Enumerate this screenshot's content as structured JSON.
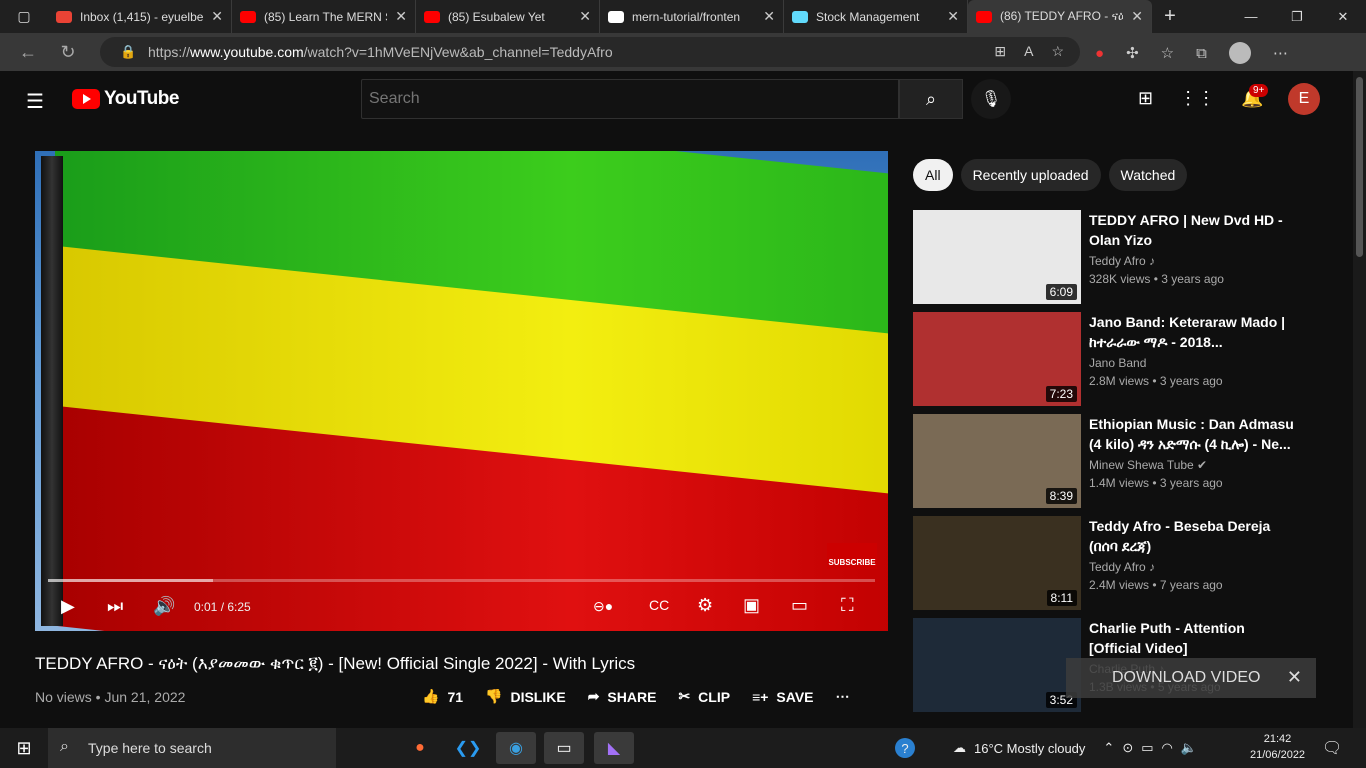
{
  "browser": {
    "tabs": [
      {
        "title": "Inbox (1,415) - eyuelbe",
        "favicon_color": "#ea4335",
        "icon": "gmail-icon"
      },
      {
        "title": "(85) Learn The MERN S",
        "favicon_color": "#ff0000",
        "icon": "youtube-icon"
      },
      {
        "title": "(85) Esubalew Yet",
        "favicon_color": "#ff0000",
        "icon": "youtube-icon"
      },
      {
        "title": "mern-tutorial/fronten",
        "favicon_color": "#ffffff",
        "icon": "github-icon"
      },
      {
        "title": "Stock Management",
        "favicon_color": "#61dafb",
        "icon": "react-icon"
      },
      {
        "title": "(86) TEDDY AFRO - ናዕ",
        "favicon_color": "#ff0000",
        "icon": "youtube-icon"
      }
    ],
    "url_prefix": "https://",
    "url_host": "www.youtube.com",
    "url_path": "/watch?v=1hMVeENjVew&ab_channel=TeddyAfro"
  },
  "youtube": {
    "logo_text": "YouTube",
    "search_placeholder": "Search",
    "notification_count": "9+",
    "avatar_letter": "E"
  },
  "player": {
    "time": "0:01 / 6:25",
    "progress_fraction": 0.0026,
    "loaded_fraction": 0.2,
    "subscribe_badge": "SUBSCRIBE"
  },
  "video": {
    "title": "TEDDY AFRO - ናዕት (እያመመው ቁጥር ፪) - [New! Official Single 2022] - With Lyrics",
    "meta": "No views • Jun 21, 2022",
    "likes": "71",
    "dislike_label": "DISLIKE",
    "share_label": "SHARE",
    "clip_label": "CLIP",
    "save_label": "SAVE"
  },
  "chips": [
    "All",
    "Recently uploaded",
    "Watched"
  ],
  "recommendations": [
    {
      "title": "TEDDY AFRO | New Dvd HD - Olan Yizo",
      "channel": "Teddy Afro ♪",
      "views": "328K views • 3 years ago",
      "duration": "6:09",
      "thumb": "#e8e8e8"
    },
    {
      "title": "Jano Band: Keteraraw Mado | ከተራራው ማዶ - 2018...",
      "channel": "Jano Band",
      "views": "2.8M views • 3 years ago",
      "duration": "7:23",
      "thumb": "#b03030"
    },
    {
      "title": "Ethiopian Music : Dan Admasu (4 kilo) ዳን አድማሱ (4 ኪሎ) - Ne...",
      "channel": "Minew Shewa Tube ✔",
      "views": "1.4M views • 3 years ago",
      "duration": "8:39",
      "thumb": "#7a6a55"
    },
    {
      "title": "Teddy Afro - Beseba Dereja (በሰባ ደረጃ)",
      "channel": "Teddy Afro ♪",
      "views": "2.4M views • 7 years ago",
      "duration": "8:11",
      "thumb": "#3a3020"
    },
    {
      "title": "Charlie Puth - Attention [Official Video]",
      "channel": "Charlie Puth ♪",
      "views": "1.3B views • 5 years ago",
      "duration": "3:52",
      "thumb": "#1e2a38"
    }
  ],
  "download_popup": "DOWNLOAD VIDEO",
  "taskbar": {
    "search_placeholder": "Type here to search",
    "weather": "16°C  Mostly cloudy",
    "time": "21:42",
    "date": "21/06/2022"
  }
}
